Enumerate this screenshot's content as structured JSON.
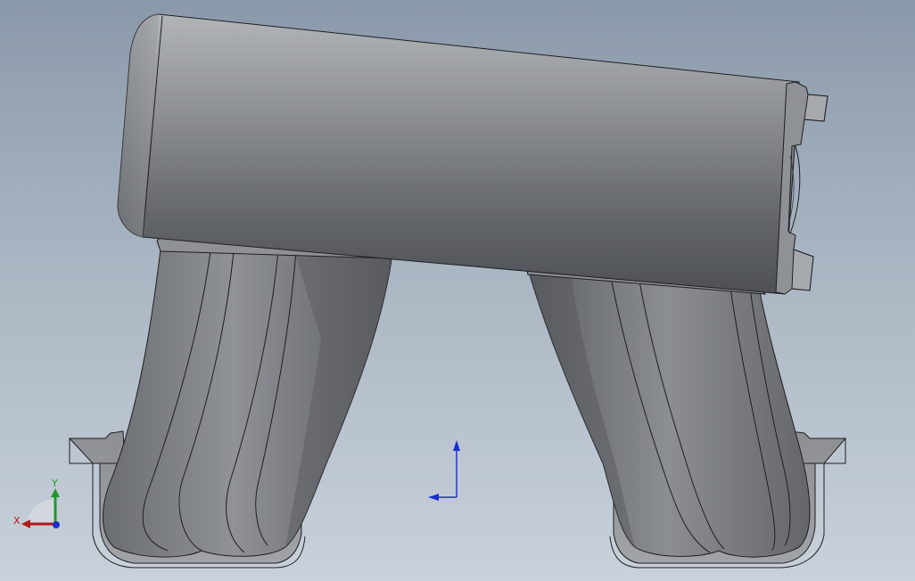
{
  "viewport": {
    "model_name": "intake-manifold",
    "colors": {
      "background_top": "#8a99aa",
      "background_bottom": "#c9d1da",
      "body_light": "#a6a9ad",
      "body_dark": "#55585c",
      "edge": "#1e1f21"
    }
  },
  "triad": {
    "x_label": "X",
    "y_label": "Y",
    "x_color": "#b31a1a",
    "y_color": "#1f9a2a",
    "z_color": "#1b2fd0"
  },
  "origin_marker": {
    "color": "#1b2fd0"
  }
}
